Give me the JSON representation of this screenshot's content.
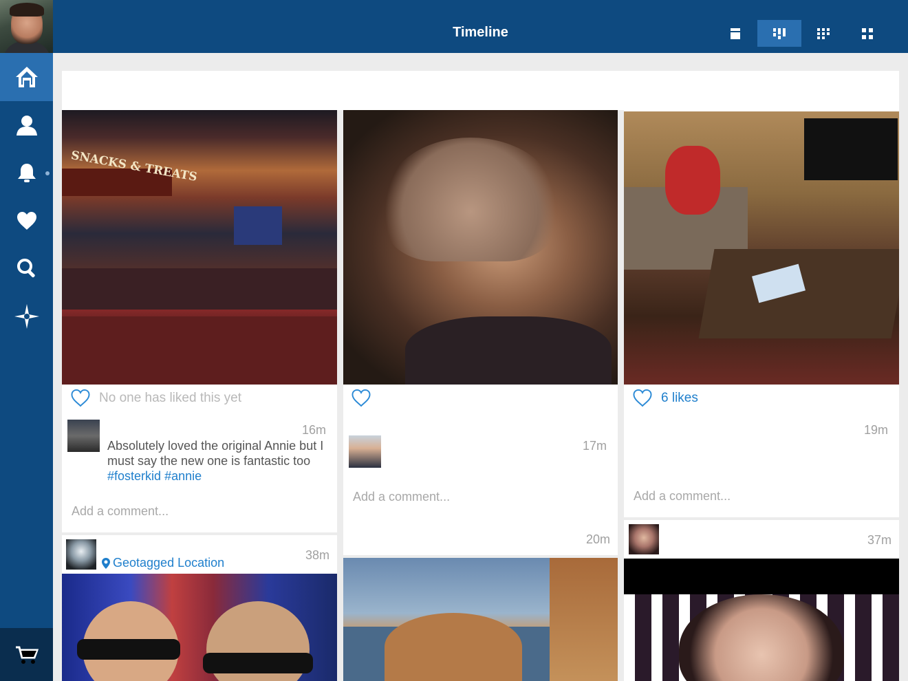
{
  "header": {
    "title": "Timeline"
  },
  "sidebar": {
    "items": [
      {
        "name": "home",
        "icon": "home-icon",
        "active": true
      },
      {
        "name": "profile",
        "icon": "person-icon"
      },
      {
        "name": "notifications",
        "icon": "bell-icon"
      },
      {
        "name": "likes",
        "icon": "heart-icon"
      },
      {
        "name": "search",
        "icon": "search-icon"
      },
      {
        "name": "explore",
        "icon": "compass-icon"
      }
    ],
    "cart_icon": "cart-icon"
  },
  "view_modes": [
    {
      "icon": "single-column-icon",
      "active": false
    },
    {
      "icon": "masonry-icon",
      "active": true
    },
    {
      "icon": "small-grid-icon",
      "active": false
    },
    {
      "icon": "large-grid-icon",
      "active": false
    }
  ],
  "posts": [
    {
      "column": 1,
      "likes_text": "No one has liked this yet",
      "time": "16m",
      "comment": {
        "text_before": "Absolutely loved the original Annie but I must say the new one is fantastic too ",
        "tag1": "#fosterkid",
        "tag2": "#annie"
      },
      "add_comment_placeholder": "Add a comment..."
    },
    {
      "column": 2,
      "likes_text": "",
      "time": "17m",
      "add_comment_placeholder": "Add a comment..."
    },
    {
      "column": 3,
      "likes_text": "6 likes",
      "time": "19m",
      "add_comment_placeholder": "Add a comment..."
    },
    {
      "column": 1,
      "location": "Geotagged Location",
      "time": "38m"
    },
    {
      "column": 2,
      "time": "20m"
    },
    {
      "column": 3,
      "time": "37m"
    }
  ],
  "colors": {
    "primary": "#0e4a80",
    "active": "#2a6fb0",
    "link": "#1f7fcc"
  }
}
